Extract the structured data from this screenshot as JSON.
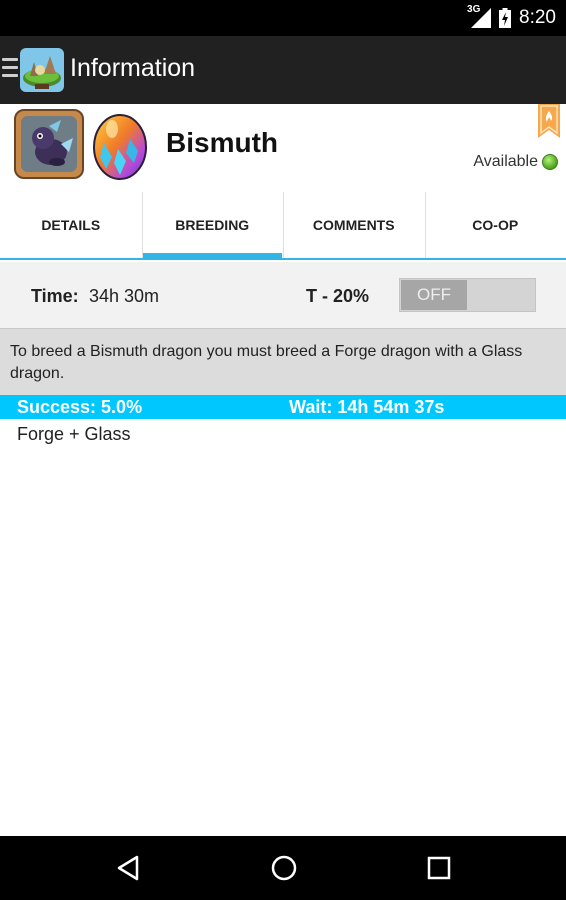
{
  "status_bar": {
    "network": "3G",
    "time": "8:20"
  },
  "action_bar": {
    "title": "Information"
  },
  "dragon": {
    "name": "Bismuth",
    "availability": "Available",
    "availability_color": "#4faa22"
  },
  "tabs": [
    {
      "label": "DETAILS",
      "active": false
    },
    {
      "label": "BREEDING",
      "active": true
    },
    {
      "label": "COMMENTS",
      "active": false
    },
    {
      "label": "CO-OP",
      "active": false
    }
  ],
  "breeding": {
    "time_label": "Time:",
    "time_value": "34h 30m",
    "bonus_label": "T - 20%",
    "toggle_label": "OFF",
    "toggle_on": false,
    "description": "To breed a Bismuth dragon you must breed a Forge dragon with a Glass dragon.",
    "success": "Success: 5.0%",
    "wait": "Wait: 14h 54m 37s",
    "combination": "Forge + Glass"
  },
  "colors": {
    "accent": "#33b5e5",
    "result_highlight": "#00c8ff",
    "action_bar": "#212121"
  },
  "nav": {
    "back_icon": "back-triangle-icon",
    "home_icon": "home-circle-icon",
    "recents_icon": "recents-square-icon"
  }
}
